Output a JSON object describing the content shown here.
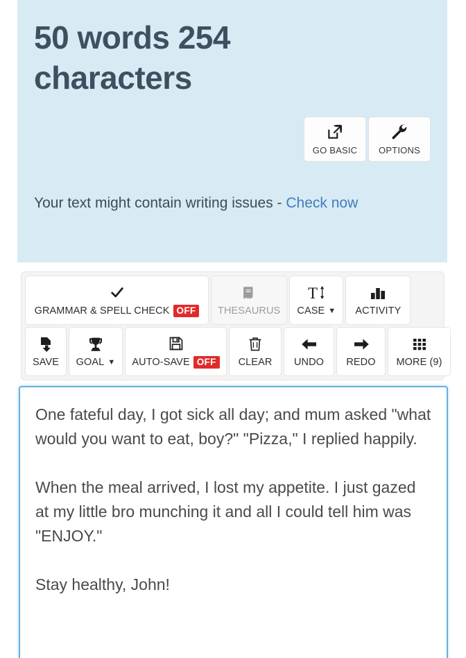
{
  "header": {
    "counter_title": "50 words 254 characters",
    "bg_color": "#d8eaf4",
    "title_color": "#3f4f5f",
    "buttons": [
      {
        "label": "GO BASIC",
        "icon": "external-link-icon"
      },
      {
        "label": "OPTIONS",
        "icon": "wrench-icon"
      }
    ],
    "notice": {
      "text": "Your text might contain writing issues - ",
      "link_label": "Check now",
      "link_color": "#3d7ebb"
    }
  },
  "toolbar": {
    "badge_off_label": "OFF",
    "badge_off_color": "#e02b2b",
    "row1": [
      {
        "label": "GRAMMAR & SPELL CHECK",
        "icon": "check-icon",
        "badge": "OFF",
        "disabled": false,
        "caret": false
      },
      {
        "label": "THESAURUS",
        "icon": "book-icon",
        "badge": null,
        "disabled": true,
        "caret": false
      },
      {
        "label": "CASE",
        "icon": "text-case-icon",
        "badge": null,
        "disabled": false,
        "caret": true
      },
      {
        "label": "ACTIVITY",
        "icon": "bar-chart-icon",
        "badge": null,
        "disabled": false,
        "caret": false
      }
    ],
    "row2": [
      {
        "label": "SAVE",
        "icon": "file-download-icon",
        "badge": null,
        "disabled": false,
        "caret": false
      },
      {
        "label": "GOAL",
        "icon": "trophy-icon",
        "badge": null,
        "disabled": false,
        "caret": true
      },
      {
        "label": "AUTO-SAVE",
        "icon": "floppy-disk-icon",
        "badge": "OFF",
        "disabled": false,
        "caret": false
      },
      {
        "label": "CLEAR",
        "icon": "trash-icon",
        "badge": null,
        "disabled": false,
        "caret": false
      },
      {
        "label": "UNDO",
        "icon": "arrow-left-icon",
        "badge": null,
        "disabled": false,
        "caret": false
      },
      {
        "label": "REDO",
        "icon": "arrow-right-icon",
        "badge": null,
        "disabled": false,
        "caret": false
      },
      {
        "label": "MORE (9)",
        "icon": "grid-icon",
        "badge": null,
        "disabled": false,
        "caret": false
      }
    ]
  },
  "editor": {
    "value": "One fateful day, I got sick all day; and mum asked \"what would you want to eat, boy?\" \"Pizza,\" I replied happily.\n\nWhen the meal arrived, I lost my appetite. I just gazed at my little bro munching it and all I could tell him was \"ENJOY.\"\n\nStay healthy, John!",
    "placeholder": "",
    "border_color": "#67afe0"
  }
}
